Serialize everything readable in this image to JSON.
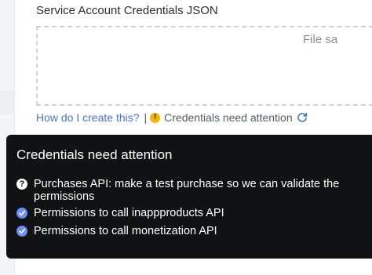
{
  "form": {
    "field_label": "Service Account Credentials JSON",
    "dropzone_text": "File sa",
    "help_link": "How do I create this?",
    "separator": "|",
    "warning_glyph": "!",
    "status_text": "Credentials need attention"
  },
  "tooltip": {
    "title": "Credentials need attention",
    "items": [
      {
        "icon": "question-icon",
        "glyph": "?",
        "text": "Purchases API: make a test purchase so we can validate the permissions"
      },
      {
        "icon": "check-icon",
        "text": "Permissions to call inappproducts API"
      },
      {
        "icon": "check-icon",
        "text": "Permissions to call monetization API"
      }
    ]
  },
  "colors": {
    "link": "#4a73c9",
    "warning": "#f5b400",
    "check": "#6d8ef2",
    "tooltip_bg": "#111214"
  }
}
